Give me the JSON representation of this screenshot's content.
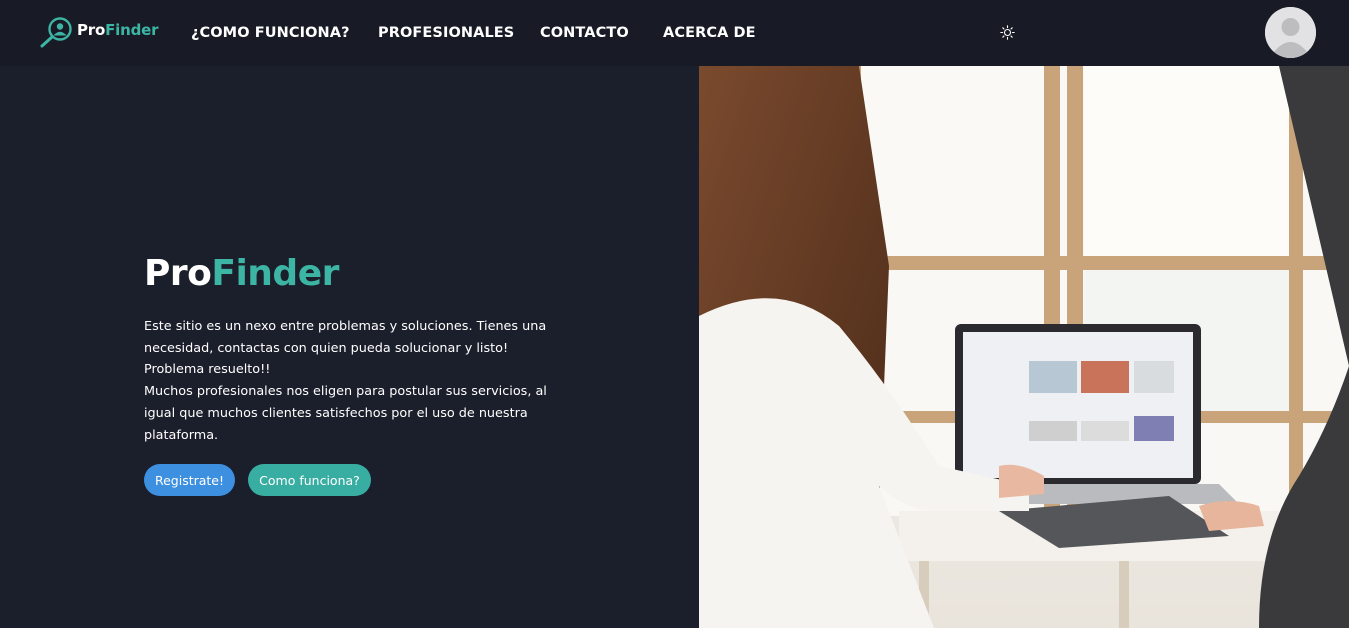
{
  "brand": {
    "pro": "Pro",
    "finder": "Finder"
  },
  "nav": {
    "items": [
      {
        "label": "¿COMO FUNCIONA?"
      },
      {
        "label": "PROFESIONALES"
      },
      {
        "label": "CONTACTO"
      },
      {
        "label": "ACERCA DE"
      }
    ],
    "theme_icon": "sun-icon",
    "avatar_icon": "user-avatar-icon"
  },
  "hero": {
    "title_pro": "Pro",
    "title_finder": "Finder",
    "paragraph_1": "Este sitio es un nexo entre problemas y soluciones. Tienes una necesidad, contactas con quien pueda solucionar y listo! Problema resuelto!!",
    "paragraph_2": "Muchos profesionales nos eligen para postular sus servicios, al igual que muchos clientes satisfechos por el uso de nuestra plataforma.",
    "register_label": "Registrate!",
    "how_label": "Como funciona?"
  },
  "colors": {
    "background": "#1b1e2b",
    "navbar": "#181b25",
    "accent_teal": "#3db5a5",
    "button_blue": "#3d8fe0",
    "button_teal": "#38ada2"
  }
}
